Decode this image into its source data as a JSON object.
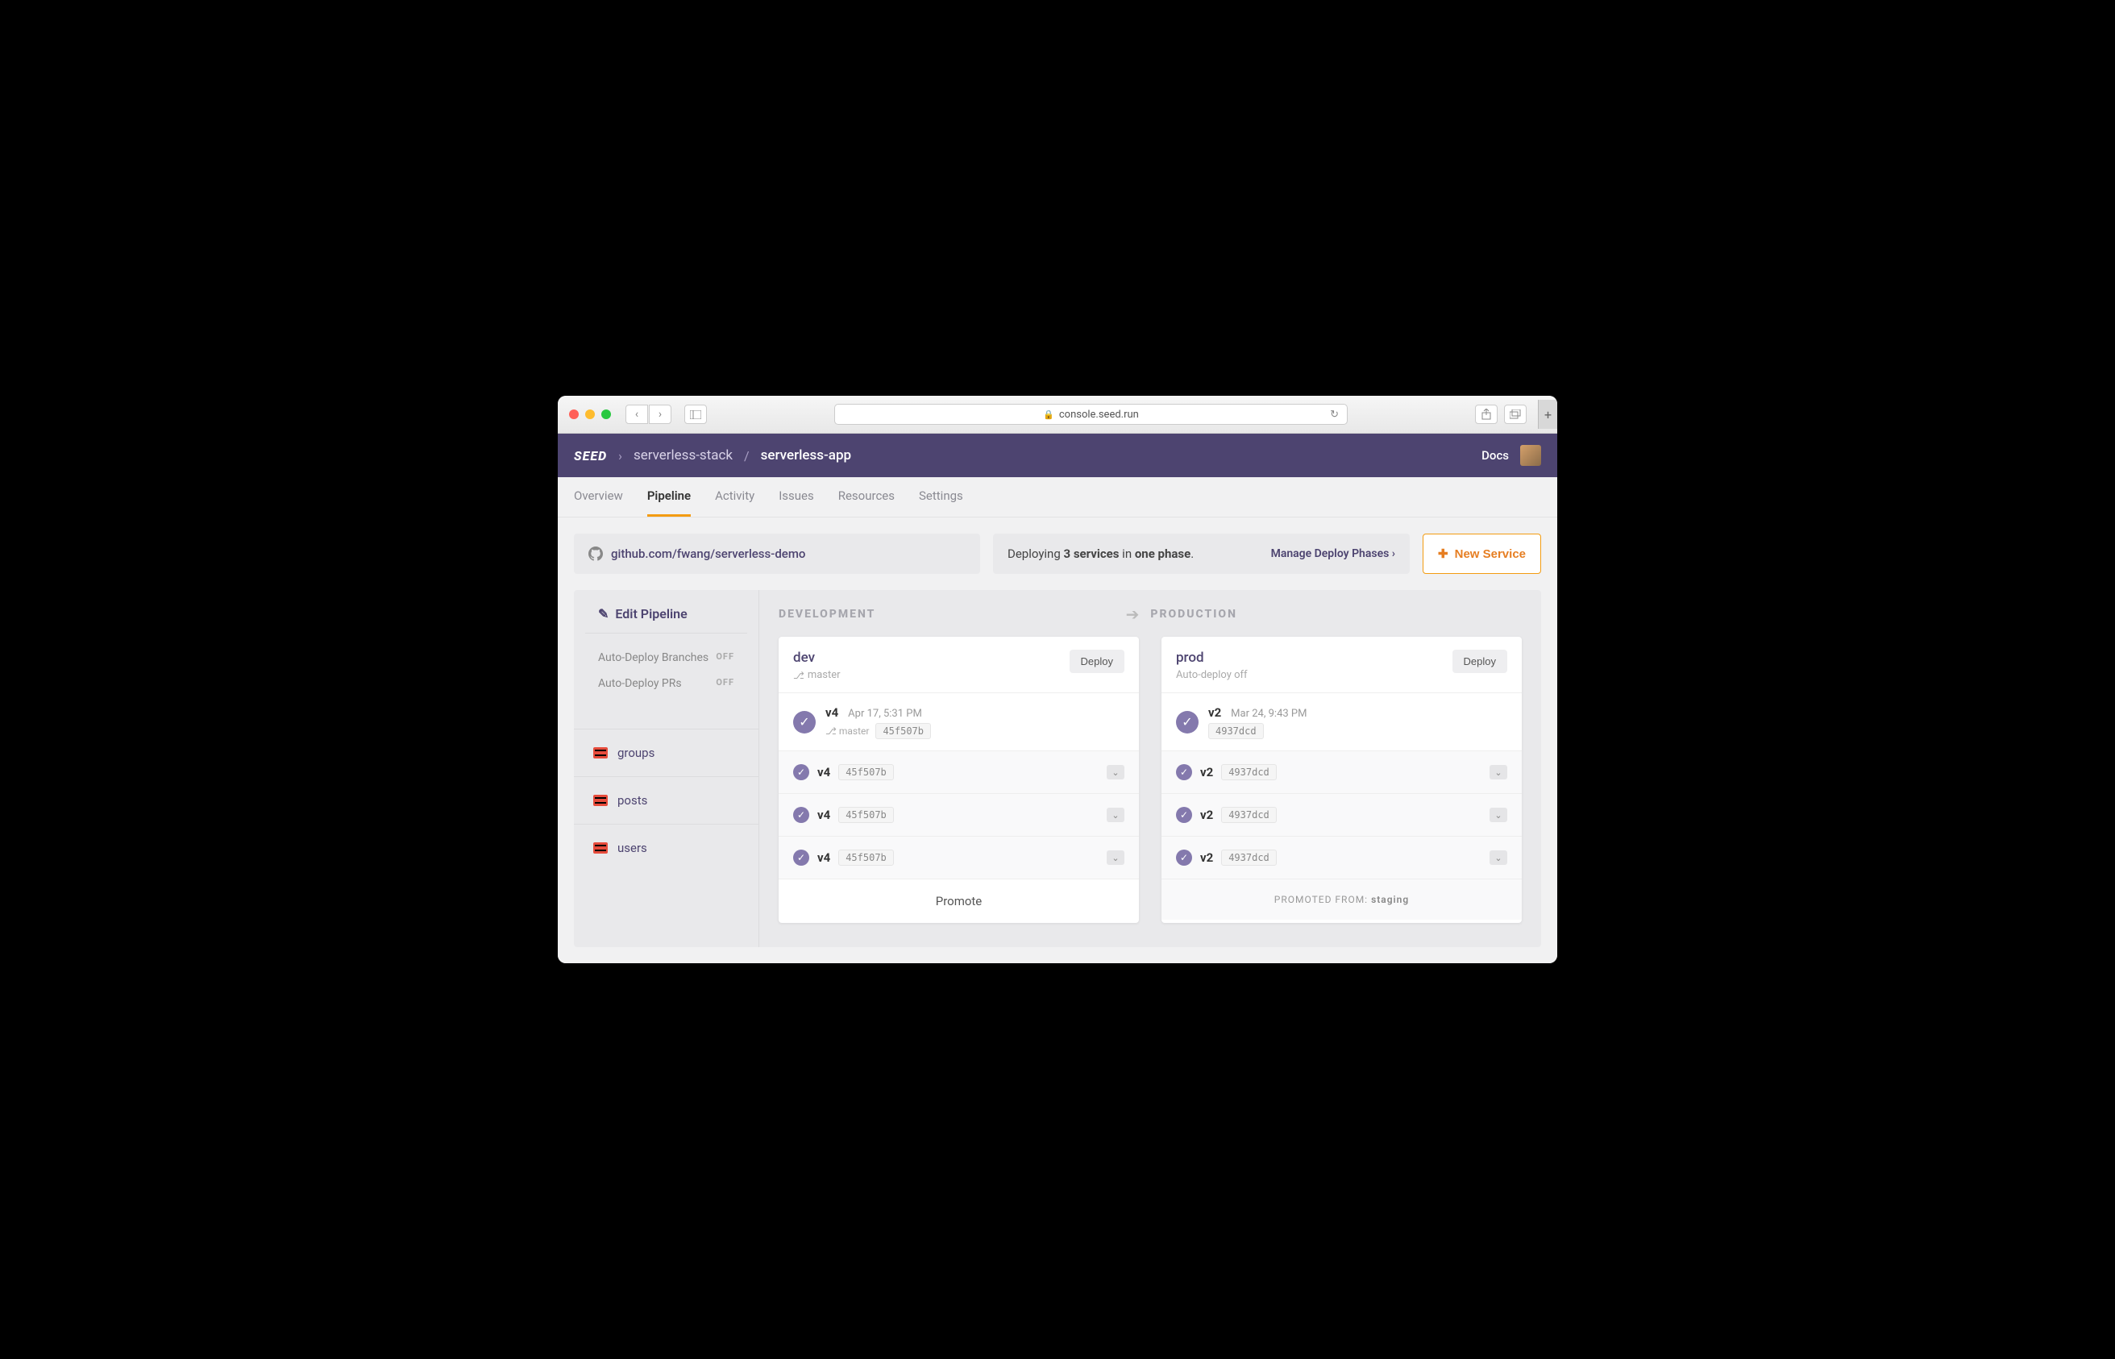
{
  "browser": {
    "url": "console.seed.run"
  },
  "header": {
    "logo": "SEED",
    "breadcrumb": [
      "serverless-stack",
      "serverless-app"
    ],
    "docs": "Docs"
  },
  "tabs": [
    "Overview",
    "Pipeline",
    "Activity",
    "Issues",
    "Resources",
    "Settings"
  ],
  "activeTab": 1,
  "repo": {
    "url": "github.com/fwang/serverless-demo"
  },
  "deploy_summary": {
    "prefix": "Deploying ",
    "services": "3 services",
    "mid": " in ",
    "phase": "one phase",
    "suffix": ".",
    "manage": "Manage Deploy Phases"
  },
  "new_service": "New Service",
  "sidebar": {
    "edit": "Edit Pipeline",
    "auto_branches": {
      "label": "Auto-Deploy Branches",
      "state": "OFF"
    },
    "auto_prs": {
      "label": "Auto-Deploy PRs",
      "state": "OFF"
    },
    "services": [
      "groups",
      "posts",
      "users"
    ]
  },
  "stages": {
    "dev": {
      "header": "DEVELOPMENT",
      "name": "dev",
      "branch": "master",
      "deploy": "Deploy",
      "build": {
        "version": "v4",
        "time": "Apr 17, 5:31 PM",
        "branch": "master",
        "hash": "45f507b"
      },
      "services": [
        {
          "version": "v4",
          "hash": "45f507b"
        },
        {
          "version": "v4",
          "hash": "45f507b"
        },
        {
          "version": "v4",
          "hash": "45f507b"
        }
      ],
      "footer": "Promote"
    },
    "prod": {
      "header": "PRODUCTION",
      "name": "prod",
      "sub": "Auto-deploy off",
      "deploy": "Deploy",
      "build": {
        "version": "v2",
        "time": "Mar 24, 9:43 PM",
        "hash": "4937dcd"
      },
      "services": [
        {
          "version": "v2",
          "hash": "4937dcd"
        },
        {
          "version": "v2",
          "hash": "4937dcd"
        },
        {
          "version": "v2",
          "hash": "4937dcd"
        }
      ],
      "footer_label": "PROMOTED FROM: ",
      "footer_value": "staging"
    }
  }
}
